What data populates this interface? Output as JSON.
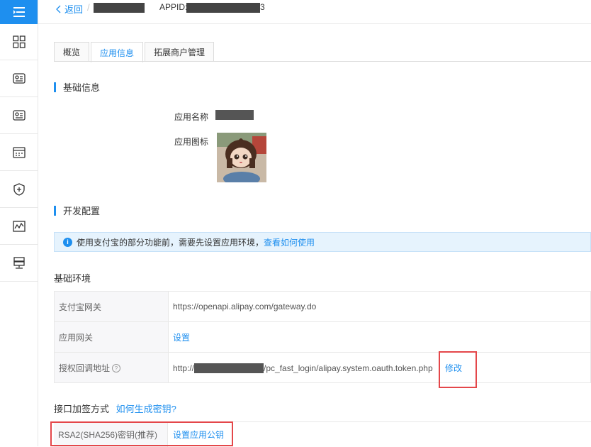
{
  "topbar": {
    "back_label": "返回",
    "separator": "/",
    "appid_label": "APPID:",
    "appid_tail": "3"
  },
  "tabs": [
    {
      "label": "概览"
    },
    {
      "label": "应用信息"
    },
    {
      "label": "拓展商户管理"
    }
  ],
  "basic_info": {
    "title": "基础信息",
    "name_label": "应用名称",
    "icon_label": "应用图标"
  },
  "dev_config": {
    "title": "开发配置",
    "notice_text": "使用支付宝的部分功能前，需要先设置应用环境，",
    "notice_link": "查看如何使用"
  },
  "env": {
    "title": "基础环境",
    "rows": [
      {
        "key": "支付宝网关",
        "value": "https://openapi.alipay.com/gateway.do"
      },
      {
        "key": "应用网关",
        "value": "设置"
      },
      {
        "key": "授权回调地址",
        "value_prefix": "http://",
        "value_suffix": "/pc_fast_login/alipay.system.oauth.token.php",
        "action": "修改"
      }
    ]
  },
  "sign": {
    "title": "接口加签方式",
    "help_link": "如何生成密钥?",
    "row_key": "RSA2(SHA256)密钥(推荐)",
    "row_value": "设置应用公钥"
  },
  "colors": {
    "accent": "#1e8fef",
    "highlight_box": "#e4474a"
  }
}
